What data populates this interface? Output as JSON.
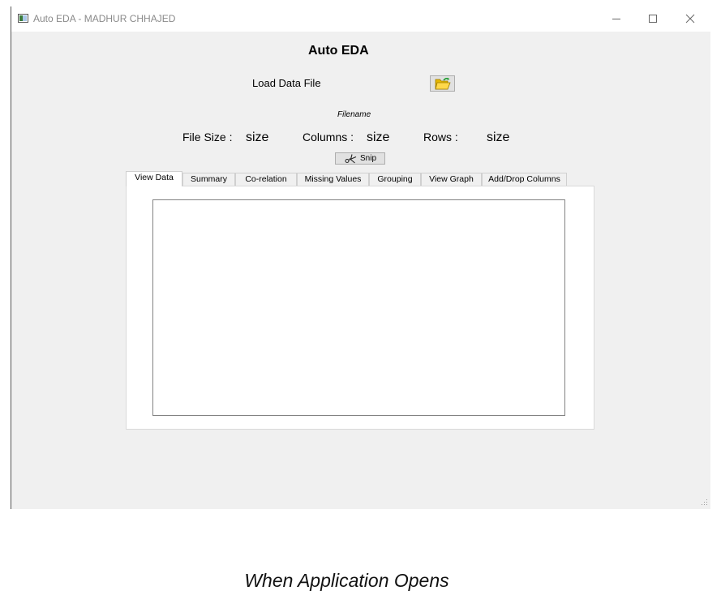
{
  "window": {
    "title": "Auto EDA - MADHUR CHHAJED",
    "controls": {
      "minimize": "minimize-icon",
      "maximize": "maximize-icon",
      "close": "close-icon"
    }
  },
  "header": {
    "title": "Auto EDA"
  },
  "load": {
    "label": "Load Data File",
    "button_icon": "folder-open-icon"
  },
  "file": {
    "name": "Filename"
  },
  "stats": {
    "file_size_label": "File Size :",
    "file_size_value": "size",
    "columns_label": "Columns :",
    "columns_value": "size",
    "rows_label": "Rows :",
    "rows_value": "size"
  },
  "snip": {
    "label": "Snip",
    "icon": "scissors-icon"
  },
  "tabs": [
    {
      "label": "View Data",
      "active": true
    },
    {
      "label": "Summary",
      "active": false
    },
    {
      "label": "Co-relation",
      "active": false
    },
    {
      "label": "Missing Values",
      "active": false
    },
    {
      "label": "Grouping",
      "active": false
    },
    {
      "label": "View Graph",
      "active": false
    },
    {
      "label": "Add/Drop Columns",
      "active": false
    }
  ],
  "caption": "When Application Opens",
  "colors": {
    "window_bg": "#f0f0f0",
    "titlebar_bg": "#ffffff",
    "title_text": "#8a8a8a",
    "button_bg": "#e1e1e1",
    "folder": "#f2c200"
  }
}
